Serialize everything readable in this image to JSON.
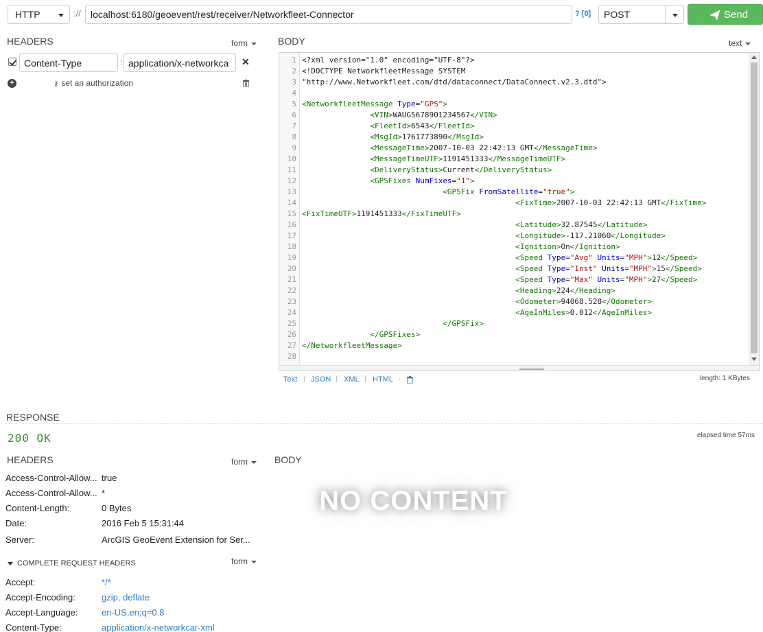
{
  "request": {
    "protocol": "HTTP",
    "separator": "://",
    "url": "localhost:6180/geoevent/rest/receiver/Networkfleet-Connector",
    "query_count": "? [0]",
    "method": "POST",
    "send_label": "Send"
  },
  "headers_section": {
    "title": "HEADERS",
    "mode": "form",
    "items": [
      {
        "name": "Content-Type",
        "value": "application/x-networkca"
      }
    ],
    "auth_label": "set an authorization"
  },
  "body_section": {
    "title": "BODY",
    "mode": "text",
    "line_numbers": [
      "1",
      "2",
      "3",
      "4",
      "5",
      "6",
      "7",
      "8",
      "9",
      "10",
      "11",
      "12",
      "13",
      "14",
      "15",
      "16",
      "17",
      "18",
      "19",
      "20",
      "21",
      "22",
      "23",
      "24",
      "25",
      "26",
      "27",
      "28"
    ],
    "lines": [
      "<?xml version=\"1.0\" encoding=\"UTF-8\"?>",
      "<!DOCTYPE NetworkfleetMessage SYSTEM",
      "\"http://www.Networkfleet.com/dtd/dataconnect/DataConnect.v2.3.dtd\">",
      "",
      "<NetworkfleetMessage Type=\"GPS\">",
      "               <VIN>WAUG5678901234567</VIN>",
      "               <FleetId>6543</FleetId>",
      "               <MsgId>1761773890</MsgId>",
      "               <MessageTime>2007-10-03 22:42:13 GMT</MessageTime>",
      "               <MessageTimeUTF>1191451333</MessageTimeUTF>",
      "               <DeliveryStatus>Current</DeliveryStatus>",
      "               <GPSFixes NumFixes=\"1\">",
      "                               <GPSFix FromSatellite=\"true\">",
      "                                               <FixTime>2007-10-03 22:42:13 GMT</FixTime>",
      "<FixTimeUTF>1191451333</FixTimeUTF>",
      "                                               <Latitude>32.87545</Latitude>",
      "                                               <Longitude>-117.21060</Longitude>",
      "                                               <Ignition>On</Ignition>",
      "                                               <Speed Type=\"Avg\" Units=\"MPH\">12</Speed>",
      "                                               <Speed Type=\"Inst\" Units=\"MPH\">15</Speed>",
      "                                               <Speed Type=\"Max\" Units=\"MPH\">27</Speed>",
      "                                               <Heading>224</Heading>",
      "                                               <Odometer>94068.528</Odometer>",
      "                                               <AgeInMiles>0.012</AgeInMiles>",
      "                               </GPSFix>",
      "               </GPSFixes>",
      "</NetworkfleetMessage>",
      ""
    ],
    "formats": [
      "Text",
      "JSON",
      "XML",
      "HTML"
    ],
    "length": "length: 1 KBytes"
  },
  "response": {
    "title": "RESPONSE",
    "status": "200 OK",
    "elapsed": "elapsed time 57ms",
    "headers_title": "HEADERS",
    "headers_mode": "form",
    "body_title": "BODY",
    "no_content": "NO CONTENT",
    "headers": [
      {
        "name": "Access-Control-Allow...",
        "value": "true"
      },
      {
        "name": "Access-Control-Allow...",
        "value": "*"
      },
      {
        "name": "Content-Length:",
        "value": "0 Bytes"
      },
      {
        "name": "Date:",
        "value": "2016 Feb 5 15:31:44"
      },
      {
        "name": "Server:",
        "value": "ArcGIS GeoEvent Extension for Ser..."
      }
    ],
    "complete_label": "COMPLETE REQUEST HEADERS",
    "complete_mode": "form",
    "request_headers": [
      {
        "name": "Accept:",
        "value": "*/*"
      },
      {
        "name": "Accept-Encoding:",
        "value": "gzip, deflate"
      },
      {
        "name": "Accept-Language:",
        "value": "en-US,en;q=0.8"
      },
      {
        "name": "Content-Type:",
        "value": "application/x-networkcar-xml"
      }
    ]
  },
  "icons": {
    "send": "paper-plane-icon",
    "remove": "close-icon",
    "add": "plus-circle-icon",
    "auth": "key-icon",
    "delete": "trash-icon"
  },
  "colors": {
    "send": "#5cb85c",
    "link": "#2a7fc9",
    "status_ok": "#3a8f2b",
    "xml_tag": "#117700",
    "xml_attr": "#0000cc",
    "xml_string": "#aa1111"
  }
}
